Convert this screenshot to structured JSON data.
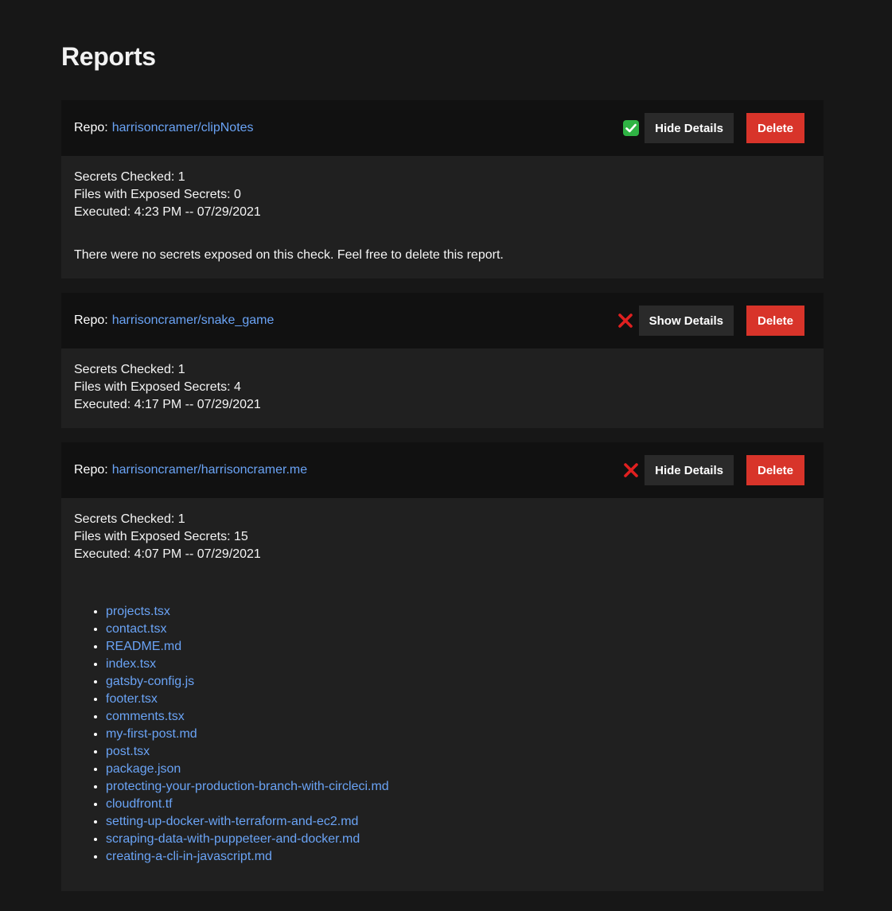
{
  "page": {
    "title": "Reports"
  },
  "colors": {
    "background": "#171717",
    "header_bg": "#111111",
    "card_bg": "#202020",
    "link": "#6aa3f5",
    "delete": "#d8342a",
    "success": "#2fb344",
    "error": "#e02020"
  },
  "labels": {
    "repo_prefix": "Repo:",
    "secrets_checked_prefix": "Secrets Checked:",
    "files_exposed_prefix": "Files with Exposed Secrets:",
    "executed_prefix": "Executed:",
    "delete": "Delete"
  },
  "reports": [
    {
      "repo": "harrisoncramer/clipNotes",
      "status_icon": "check-icon",
      "toggle_label": "Hide Details",
      "secrets_checked": "1",
      "files_exposed": "0",
      "executed": "4:23 PM -- 07/29/2021",
      "message": "There were no secrets exposed on this check. Feel free to delete this report."
    },
    {
      "repo": "harrisoncramer/snake_game",
      "status_icon": "cross-icon",
      "toggle_label": "Show Details",
      "secrets_checked": "1",
      "files_exposed": "4",
      "executed": "4:17 PM -- 07/29/2021"
    },
    {
      "repo": "harrisoncramer/harrisoncramer.me",
      "status_icon": "cross-icon",
      "toggle_label": "Hide Details",
      "secrets_checked": "1",
      "files_exposed": "15",
      "executed": "4:07 PM -- 07/29/2021",
      "files": [
        "projects.tsx",
        "contact.tsx",
        "README.md",
        "index.tsx",
        "gatsby-config.js",
        "footer.tsx",
        "comments.tsx",
        "my-first-post.md",
        "post.tsx",
        "package.json",
        "protecting-your-production-branch-with-circleci.md",
        "cloudfront.tf",
        "setting-up-docker-with-terraform-and-ec2.md",
        "scraping-data-with-puppeteer-and-docker.md",
        "creating-a-cli-in-javascript.md"
      ]
    }
  ]
}
